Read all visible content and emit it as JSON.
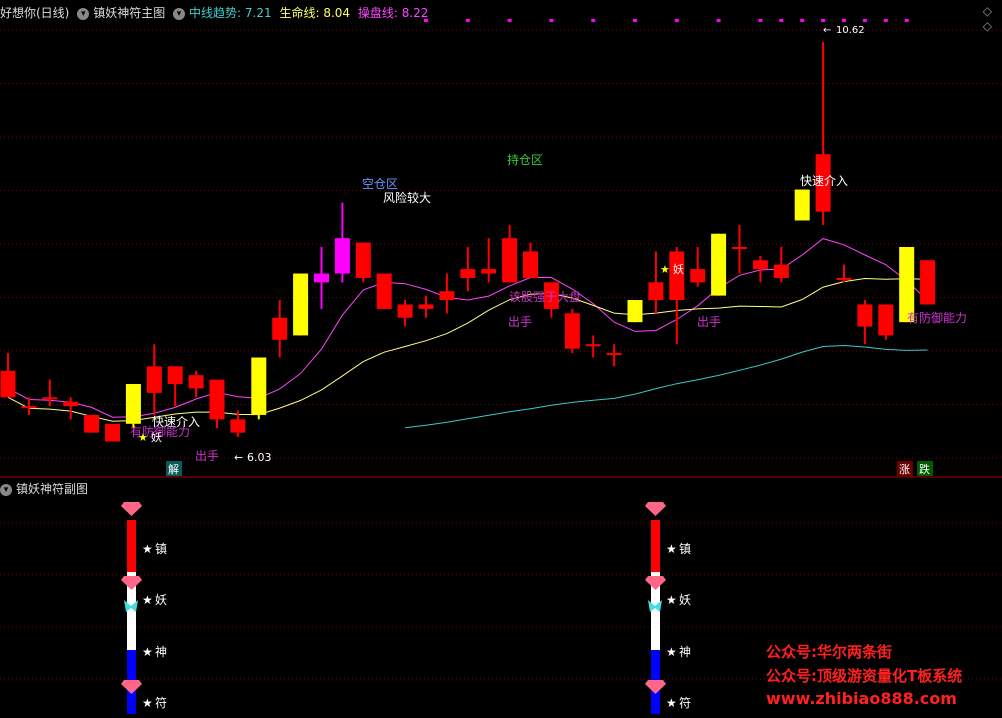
{
  "header": {
    "stock_name": "好想你(日线)",
    "main_title": "镇妖神符主图",
    "ind1_label": "中线趋势: ",
    "ind1_value": "7.21",
    "ind2_label": "生命线: ",
    "ind2_value": "8.04",
    "ind3_label": "操盘线: ",
    "ind3_value": "8.22",
    "sub_title": "镇妖神符副图"
  },
  "colors": {
    "up": "#ff0000",
    "down": "#ff0000",
    "yellow": "#ffff00",
    "magenta": "#ff00ff",
    "cyan": "#3cc8c8",
    "grid": "#7a0000"
  },
  "annotations": {
    "a1": "快速介入",
    "a2": "有防御能力",
    "a3": "妖",
    "a4": "出手",
    "a5": "6.03",
    "a6": "空仓区",
    "a7": "风险较大",
    "a8": "持仓区",
    "a9": "该股强于大盘",
    "a10": "出手",
    "a11": "妖",
    "a12": "出手",
    "a13": "快速介入",
    "a14": "10.62",
    "a15": "有防御能力",
    "tag_jie": "解",
    "tag_zhang": "涨",
    "tag_die": "跌"
  },
  "sub_labels": {
    "l1": "镇",
    "l2": "妖",
    "l3": "神",
    "l4": "符"
  },
  "watermark": {
    "line1": "公众号:华尔两条街",
    "line2": "公众号:顶级游资量化T板系统",
    "line3": "www.zhibiao888.com"
  },
  "chart_data": {
    "type": "candlestick",
    "y_range": [
      5.8,
      10.8
    ],
    "candles": [
      {
        "o": 6.9,
        "h": 7.1,
        "l": 6.6,
        "c": 6.6,
        "col": "red"
      },
      {
        "o": 6.5,
        "h": 6.6,
        "l": 6.4,
        "c": 6.5,
        "col": "red"
      },
      {
        "o": 6.6,
        "h": 6.8,
        "l": 6.5,
        "c": 6.6,
        "col": "red"
      },
      {
        "o": 6.55,
        "h": 6.6,
        "l": 6.35,
        "c": 6.5,
        "col": "red"
      },
      {
        "o": 6.4,
        "h": 6.4,
        "l": 6.2,
        "c": 6.2,
        "col": "red"
      },
      {
        "o": 6.3,
        "h": 6.3,
        "l": 6.1,
        "c": 6.1,
        "col": "red"
      },
      {
        "o": 6.3,
        "h": 6.75,
        "l": 6.25,
        "c": 6.75,
        "col": "yellow"
      },
      {
        "o": 6.65,
        "h": 7.2,
        "l": 6.4,
        "c": 6.95,
        "col": "red"
      },
      {
        "o": 6.95,
        "h": 6.95,
        "l": 6.5,
        "c": 6.75,
        "col": "red"
      },
      {
        "o": 6.85,
        "h": 6.9,
        "l": 6.6,
        "c": 6.7,
        "col": "red"
      },
      {
        "o": 6.8,
        "h": 6.8,
        "l": 6.25,
        "c": 6.35,
        "col": "red"
      },
      {
        "o": 6.35,
        "h": 6.45,
        "l": 6.15,
        "c": 6.2,
        "col": "red"
      },
      {
        "o": 6.4,
        "h": 7.05,
        "l": 6.35,
        "c": 7.05,
        "col": "yellow"
      },
      {
        "o": 7.25,
        "h": 7.7,
        "l": 7.05,
        "c": 7.5,
        "col": "red"
      },
      {
        "o": 7.3,
        "h": 8.0,
        "l": 7.3,
        "c": 8.0,
        "col": "yellow"
      },
      {
        "o": 7.9,
        "h": 8.3,
        "l": 7.6,
        "c": 8.0,
        "col": "magenta"
      },
      {
        "o": 8.4,
        "h": 8.8,
        "l": 7.9,
        "c": 8.0,
        "col": "magenta"
      },
      {
        "o": 8.35,
        "h": 8.35,
        "l": 7.9,
        "c": 7.95,
        "col": "red"
      },
      {
        "o": 8.0,
        "h": 8.0,
        "l": 7.6,
        "c": 7.6,
        "col": "red"
      },
      {
        "o": 7.65,
        "h": 7.7,
        "l": 7.4,
        "c": 7.5,
        "col": "red"
      },
      {
        "o": 7.6,
        "h": 7.75,
        "l": 7.5,
        "c": 7.65,
        "col": "red"
      },
      {
        "o": 7.7,
        "h": 8.0,
        "l": 7.55,
        "c": 7.8,
        "col": "red"
      },
      {
        "o": 8.05,
        "h": 8.3,
        "l": 7.8,
        "c": 7.95,
        "col": "red"
      },
      {
        "o": 8.0,
        "h": 8.4,
        "l": 7.9,
        "c": 8.05,
        "col": "red"
      },
      {
        "o": 8.4,
        "h": 8.55,
        "l": 7.9,
        "c": 7.9,
        "col": "red"
      },
      {
        "o": 8.25,
        "h": 8.35,
        "l": 7.95,
        "c": 7.95,
        "col": "red"
      },
      {
        "o": 7.9,
        "h": 7.9,
        "l": 7.5,
        "c": 7.6,
        "col": "red"
      },
      {
        "o": 7.55,
        "h": 7.6,
        "l": 7.1,
        "c": 7.15,
        "col": "red"
      },
      {
        "o": 7.2,
        "h": 7.3,
        "l": 7.05,
        "c": 7.2,
        "col": "red"
      },
      {
        "o": 7.1,
        "h": 7.2,
        "l": 6.95,
        "c": 7.1,
        "col": "red"
      },
      {
        "o": 7.45,
        "h": 7.7,
        "l": 7.45,
        "c": 7.7,
        "col": "yellow"
      },
      {
        "o": 7.9,
        "h": 8.25,
        "l": 7.55,
        "c": 7.7,
        "col": "red"
      },
      {
        "o": 7.7,
        "h": 8.3,
        "l": 7.2,
        "c": 8.25,
        "col": "red"
      },
      {
        "o": 8.05,
        "h": 8.3,
        "l": 7.85,
        "c": 7.9,
        "col": "red"
      },
      {
        "o": 7.75,
        "h": 8.45,
        "l": 7.75,
        "c": 8.45,
        "col": "yellow"
      },
      {
        "o": 8.3,
        "h": 8.55,
        "l": 8.0,
        "c": 8.3,
        "col": "red"
      },
      {
        "o": 8.15,
        "h": 8.2,
        "l": 7.9,
        "c": 8.05,
        "col": "red"
      },
      {
        "o": 8.1,
        "h": 8.3,
        "l": 7.9,
        "c": 7.95,
        "col": "red"
      },
      {
        "o": 8.6,
        "h": 8.95,
        "l": 8.6,
        "c": 8.95,
        "col": "yellow"
      },
      {
        "o": 9.35,
        "h": 10.62,
        "l": 8.55,
        "c": 8.7,
        "col": "red"
      },
      {
        "o": 7.95,
        "h": 8.1,
        "l": 7.9,
        "c": 7.95,
        "col": "red"
      },
      {
        "o": 7.65,
        "h": 7.7,
        "l": 7.2,
        "c": 7.4,
        "col": "red"
      },
      {
        "o": 7.65,
        "h": 7.65,
        "l": 7.25,
        "c": 7.3,
        "col": "red"
      },
      {
        "o": 7.45,
        "h": 8.3,
        "l": 7.45,
        "c": 8.3,
        "col": "yellow"
      },
      {
        "o": 8.15,
        "h": 8.15,
        "l": 7.65,
        "c": 7.65,
        "col": "red"
      }
    ]
  }
}
